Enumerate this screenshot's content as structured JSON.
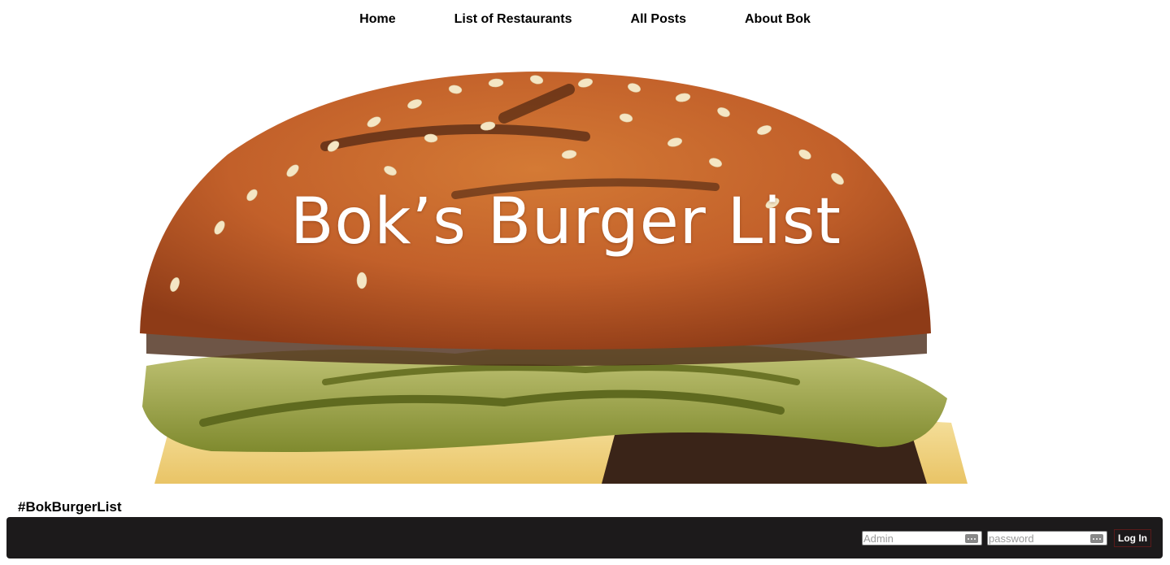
{
  "nav": {
    "items": [
      {
        "label": "Home"
      },
      {
        "label": "List of Restaurants"
      },
      {
        "label": "All Posts"
      },
      {
        "label": "About Bok"
      }
    ]
  },
  "hero": {
    "title": "Bok’s Burger List"
  },
  "hashtag": "#BokBurgerList",
  "login": {
    "username_placeholder": "Admin",
    "password_placeholder": "password",
    "submit_label": "Log In"
  },
  "colors": {
    "footer_bg": "#1c1a1b",
    "bun": "#c9692a",
    "pickle": "#8a8f3a",
    "cheese": "#f2d98a"
  }
}
